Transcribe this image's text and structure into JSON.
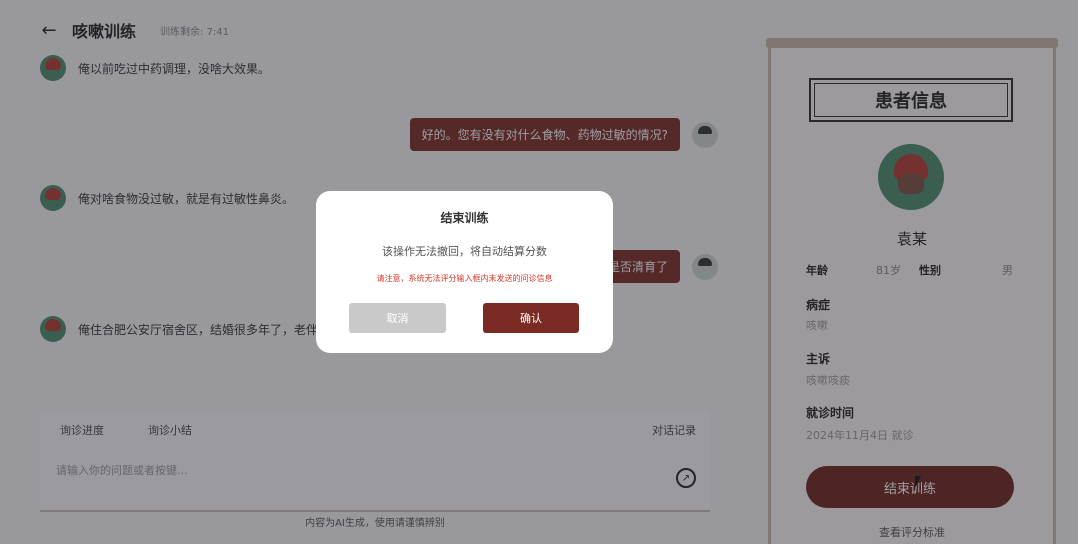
{
  "header": {
    "title": "咳嗽训练",
    "timer": "训练剩余: 7:41"
  },
  "chat": [
    {
      "role": "patient",
      "text": "俺以前吃过中药调理，没啥大效果。"
    },
    {
      "role": "doctor",
      "text": "好的。您有没有对什么食物、药物过敏的情况?"
    },
    {
      "role": "patient",
      "text": "俺对啥食物没过敏，就是有过敏性鼻炎。"
    },
    {
      "role": "doctor",
      "text": "是否清育了"
    },
    {
      "role": "patient",
      "text": "俺住合肥公安厅宿舍区，结婚很多年了，老伴"
    }
  ],
  "input_panel": {
    "tabs": [
      "询诊进度",
      "询诊小结"
    ],
    "history_link": "对话记录",
    "placeholder": "请输入你的问题或者按键...",
    "footer_note": "内容为AI生成，使用请谨慎辨别"
  },
  "card": {
    "title": "患者信息",
    "name": "袁某",
    "age_label": "年龄",
    "age_value": "81岁",
    "gender_label": "性别",
    "gender_value": "男",
    "disease_label": "病症",
    "disease_value": "咳嗽",
    "complaint_label": "主诉",
    "complaint_value": "咳嗽咳痰",
    "visit_time_label": "就诊时间",
    "visit_time_value": "2024年11月4日 就诊",
    "end_button": "结束训练",
    "criteria_link": "查看评分标准"
  },
  "modal": {
    "title": "结束训练",
    "message": "该操作无法撤回，将自动结算分数",
    "warning": "请注意，系统无法评分输入框内未发送的问诊信息",
    "cancel": "取消",
    "confirm": "确认"
  },
  "colors": {
    "accent": "#7a2a22",
    "warning": "#d03a2a"
  }
}
